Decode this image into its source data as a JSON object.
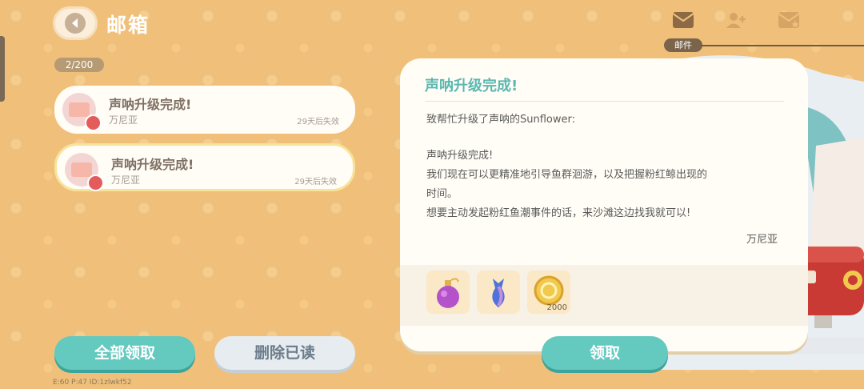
{
  "header": {
    "title": "邮箱",
    "tab_mail_label": "邮件"
  },
  "mail_count": "2/200",
  "mails": [
    {
      "title": "声呐升级完成!",
      "sender": "万尼亚",
      "expire": "29天后失效"
    },
    {
      "title": "声呐升级完成!",
      "sender": "万尼亚",
      "expire": "29天后失效"
    }
  ],
  "buttons": {
    "claim_all": "全部领取",
    "delete_read": "删除已读",
    "claim": "领取"
  },
  "detail": {
    "title": "声呐升级完成!",
    "greeting": "致帮忙升级了声呐的Sunflower:",
    "body_lines": [
      "声呐升级完成!",
      "我们现在可以更精准地引导鱼群洄游，以及把握粉红鲸出现的",
      "时间。",
      "想要主动发起粉红鱼潮事件的话，来沙滩这边找我就可以!"
    ],
    "signature": "万尼亚",
    "rewards": [
      {
        "icon": "perfume-bottle-icon",
        "count": ""
      },
      {
        "icon": "mermaid-tail-vase-icon",
        "count": ""
      },
      {
        "icon": "gold-coin-icon",
        "count": "2000"
      }
    ]
  },
  "footer_debug": "E:60 P:47 ID:1zlwkf52",
  "colors": {
    "background": "#f0c07a",
    "accent_green": "#64c9bf",
    "title_teal": "#5cb8b1",
    "badge_red": "#e35b5b"
  }
}
